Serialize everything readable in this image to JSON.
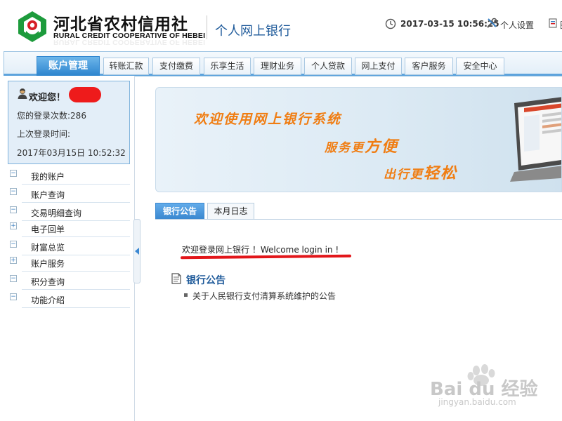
{
  "header": {
    "logo_cn": "河北省农村信用社",
    "logo_en": "RURAL CREDIT COOPERATIVE OF HEBEI",
    "site_title": "个人网上银行",
    "datetime": "2017-03-15 10:56:25",
    "settings_label": "个人设置",
    "extra_label": "图"
  },
  "nav": {
    "tabs": [
      {
        "label": "账户管理",
        "active": true
      },
      {
        "label": "转账汇款"
      },
      {
        "label": "支付缴费"
      },
      {
        "label": "乐享生活"
      },
      {
        "label": "理财业务"
      },
      {
        "label": "个人贷款"
      },
      {
        "label": "网上支付"
      },
      {
        "label": "客户服务"
      },
      {
        "label": "安全中心"
      }
    ]
  },
  "user": {
    "welcome": "欢迎您！",
    "login_count": "您的登录次数:286",
    "last_login_label": "上次登录时间:",
    "last_login_time": "2017年03月15日  10:52:32"
  },
  "menu": [
    {
      "label": "我的账户",
      "toggle": "−"
    },
    {
      "label": "账户查询",
      "toggle": "−"
    },
    {
      "label": "交易明细查询",
      "toggle": "−"
    },
    {
      "label": "电子回单",
      "toggle": "+"
    },
    {
      "label": "财富总览",
      "toggle": "−"
    },
    {
      "label": "账户服务",
      "toggle": "+"
    },
    {
      "label": "积分查询",
      "toggle": "−"
    },
    {
      "label": "功能介绍",
      "toggle": "−"
    }
  ],
  "banner": {
    "line1": "欢迎使用网上银行系统",
    "line2_pre": "服务更",
    "line2_big": "方便",
    "line3_pre": "出行更",
    "line3_big": "轻松"
  },
  "content_tabs": [
    {
      "label": "银行公告",
      "active": true
    },
    {
      "label": "本月日志"
    }
  ],
  "welcome_msg": "欢迎登录网上银行 ！Welcome login in !",
  "notice": {
    "title": "银行公告",
    "items": [
      "关于人民银行支付清算系统维护的公告"
    ]
  },
  "watermark": {
    "text": "Bai du 经验",
    "url": "jingyan.baidu.com"
  },
  "colors": {
    "brand_blue": "#2f86cf",
    "banner_orange": "#f07d12",
    "logo_green": "#1d9b3c",
    "logo_red": "#d61f26"
  }
}
